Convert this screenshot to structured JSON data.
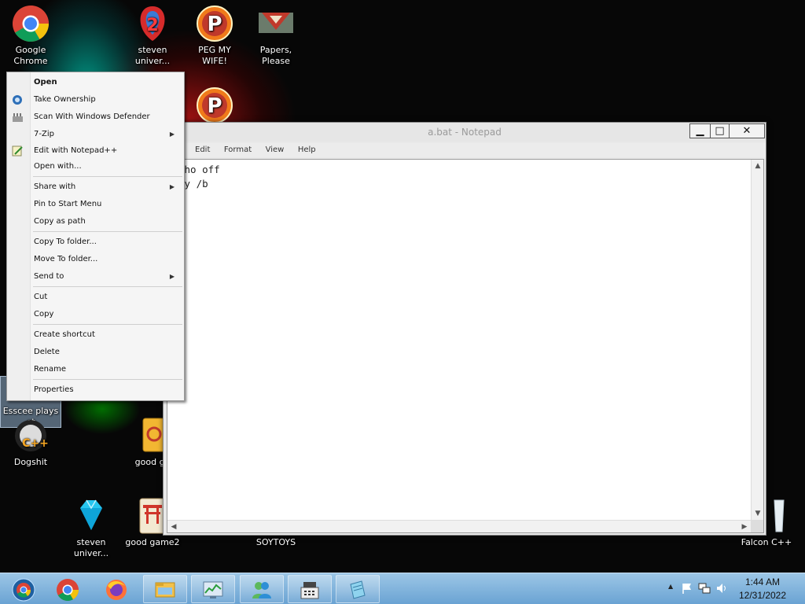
{
  "desktop": {
    "icons": [
      {
        "label": "Google Chrome",
        "icon": "chrome-icon"
      },
      {
        "label": "steven univer...",
        "icon": "steven-universe-icon"
      },
      {
        "label": "PEG MY WIFE!",
        "icon": "peggle-icon"
      },
      {
        "label": "Papers, Please",
        "icon": "papers-please-icon"
      },
      {
        "label": "Esscee plays et",
        "icon": "folder-icon"
      },
      {
        "label": "Dogshit",
        "icon": "cpp-icon"
      },
      {
        "label": "good ga",
        "icon": "mahjong-icon"
      },
      {
        "label": "steven univer...",
        "icon": "diamond-icon"
      },
      {
        "label": "good game2",
        "icon": "torii-icon"
      },
      {
        "label": "SOYTOYS",
        "icon": "blank-icon"
      },
      {
        "label": "Falcon C++",
        "icon": "recycle-bin-icon"
      }
    ]
  },
  "notepad": {
    "title": "a.bat - Notepad",
    "controls": {
      "minimize": "▁",
      "maximize": "□",
      "close": "✕"
    },
    "menu": [
      "Edit",
      "Format",
      "View",
      "Help"
    ],
    "text_lines": [
      "cho off",
      "py /b"
    ]
  },
  "context_menu": {
    "items": [
      {
        "label": "Open",
        "bold": true
      },
      {
        "label": "Take Ownership",
        "icon": "ownership-icon"
      },
      {
        "label": "Scan With Windows Defender",
        "icon": "defender-icon"
      },
      {
        "label": "7-Zip",
        "submenu": true
      },
      {
        "label": "Edit with Notepad++",
        "icon": "notepadpp-icon"
      },
      {
        "label": "Open with..."
      },
      {
        "label": "Share with",
        "submenu": true
      },
      {
        "label": "Pin to Start Menu"
      },
      {
        "label": "Copy as path"
      },
      {
        "label": "Copy To folder..."
      },
      {
        "label": "Move To folder..."
      },
      {
        "label": "Send to",
        "submenu": true
      },
      {
        "label": "Cut"
      },
      {
        "label": "Copy"
      },
      {
        "label": "Create shortcut"
      },
      {
        "label": "Delete"
      },
      {
        "label": "Rename"
      },
      {
        "label": "Properties"
      }
    ]
  },
  "taskbar": {
    "buttons": [
      "start-button",
      "chrome-icon",
      "firefox-icon",
      "explorer-icon",
      "taskmgr-icon",
      "messenger-icon",
      "cashregister-icon",
      "notepad-icon"
    ],
    "clock": {
      "time": "1:44 AM",
      "date": "12/31/2022"
    }
  }
}
